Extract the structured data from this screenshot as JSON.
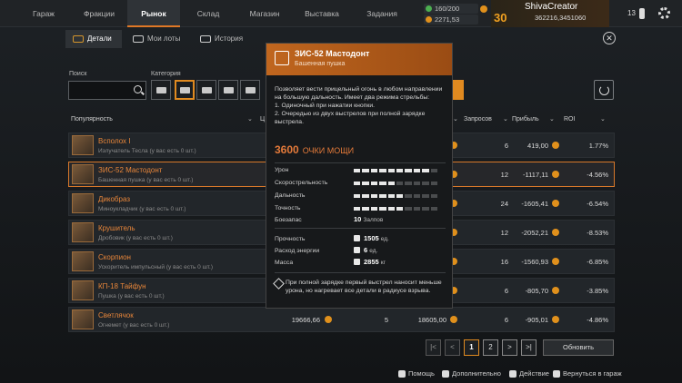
{
  "nav": {
    "tabs": [
      "Гараж",
      "Фракции",
      "Рынок",
      "Склад",
      "Магазин",
      "Выставка",
      "Задания"
    ],
    "resources": {
      "fuel": "160/200",
      "coins": "2271,53"
    },
    "user": {
      "level": "30",
      "name": "ShivaCreator",
      "id": "362216,3451060"
    },
    "notifications": "13"
  },
  "subtabs": [
    "Детали",
    "Мои лоты",
    "История"
  ],
  "filters": {
    "search_label": "Поиск",
    "category_label": "Категория"
  },
  "columns": {
    "popularity": "Популярность",
    "price_short": "Ц",
    "requests": "Запросов",
    "profit": "Прибыль",
    "roi": "ROI"
  },
  "rows": [
    {
      "name": "Всполох I",
      "sub": "Излучатель Тесла (у вас есть 0 шт.)",
      "requests": "6",
      "profit": "419,00",
      "roi": "1.77%"
    },
    {
      "name": "ЗИС-52 Мастодонт",
      "sub": "Башенная пушка (у вас есть 0 шт.)",
      "requests": "12",
      "profit": "-1117,11",
      "roi": "-4.56%"
    },
    {
      "name": "Дикобраз",
      "sub": "Миноукладчик (у вас есть 0 шт.)",
      "requests": "24",
      "profit": "-1605,41",
      "roi": "-6.54%"
    },
    {
      "name": "Крушитель",
      "sub": "Дробовик (у вас есть 0 шт.)",
      "requests": "12",
      "profit": "-2052,21",
      "roi": "-8.53%"
    },
    {
      "name": "Скорпион",
      "sub": "Ускоритель импульсный (у вас есть 0 шт.)",
      "requests": "16",
      "profit": "-1560,93",
      "roi": "-6.85%"
    },
    {
      "name": "КП-18 Тайфун",
      "sub": "Пушка (у вас есть 0 шт.)",
      "requests": "6",
      "profit": "-805,70",
      "roi": "-3.85%"
    },
    {
      "name": "Светлячок",
      "sub": "Огнемет (у вас есть 0 шт.)",
      "price": "19666,66",
      "count": "5",
      "sum": "18605,00",
      "requests": "6",
      "profit": "-905,01",
      "roi": "-4.86%"
    }
  ],
  "pager": {
    "first": "|<",
    "prev": "<",
    "p1": "1",
    "p2": "2",
    "next": ">",
    "last": ">|",
    "update": "Обновить"
  },
  "bottom": {
    "help": "Помощь",
    "more": "Дополнительно",
    "action": "Действие",
    "back": "Вернуться в гараж"
  },
  "tooltip": {
    "title": "ЗИС-52 Мастодонт",
    "subtitle": "Башенная пушка",
    "desc": "Позволяет вести прицельный огонь в любом направлении на большую дальность. Имеет два режима стрельбы:",
    "mode1": "1. Одиночный при нажатии кнопки.",
    "mode2": "2. Очередью из двух выстрелов при полной зарядке выстрела.",
    "power": "3600",
    "power_label": "ОЧКИ МОЩИ",
    "stats": [
      {
        "label": "Урон",
        "level": 0.9
      },
      {
        "label": "Скорострельность",
        "level": 0.5
      },
      {
        "label": "Дальность",
        "level": 0.6
      },
      {
        "label": "Точность",
        "level": 0.6
      }
    ],
    "ammo_label": "Боезапас",
    "ammo_value": "10",
    "ammo_unit": "Залпов",
    "durability_label": "Прочность",
    "durability_value": "1505",
    "durability_unit": "ед.",
    "energy_label": "Расход энергии",
    "energy_value": "6",
    "energy_unit": "ед.",
    "mass_label": "Масса",
    "mass_value": "2855",
    "mass_unit": "кг",
    "note": "При полной зарядке первый выстрел наносит меньше урона, но нагревает все детали в радиусе взрыва."
  }
}
